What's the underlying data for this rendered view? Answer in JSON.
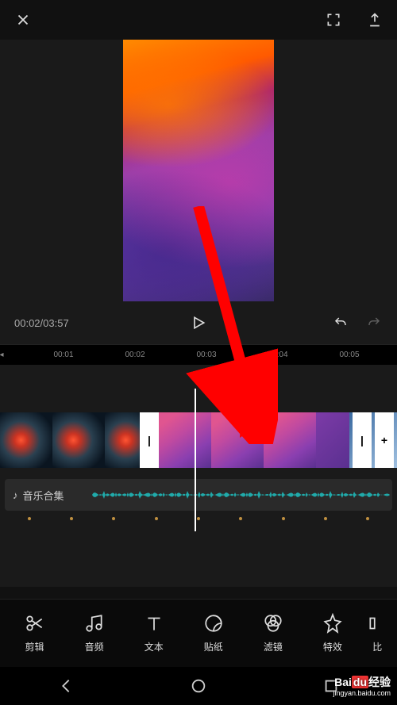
{
  "playback": {
    "current_time": "00:02",
    "total_time": "03:57",
    "separator": "/"
  },
  "ruler": {
    "marks": [
      "00:01",
      "00:02",
      "00:03",
      "00:04",
      "00:05"
    ]
  },
  "audio": {
    "icon": "music-note-icon",
    "label": "音乐合集"
  },
  "tools": [
    {
      "icon": "scissors-icon",
      "label": "剪辑"
    },
    {
      "icon": "music-icon",
      "label": "音频"
    },
    {
      "icon": "text-icon",
      "label": "文本"
    },
    {
      "icon": "sticker-icon",
      "label": "贴纸"
    },
    {
      "icon": "filter-icon",
      "label": "滤镜"
    },
    {
      "icon": "effects-icon",
      "label": "特效"
    },
    {
      "icon": "ratio-icon",
      "label": "比"
    }
  ],
  "handles": {
    "trim_left": "|",
    "trim_right": "|",
    "add": "+"
  },
  "watermark": {
    "brand_prefix": "Bai",
    "brand_mid": "du",
    "brand_suffix": "经验",
    "url": "jingyan.baidu.com"
  },
  "colors": {
    "accent_arrow": "#ff0000",
    "waveform": "#1fb8b8"
  }
}
